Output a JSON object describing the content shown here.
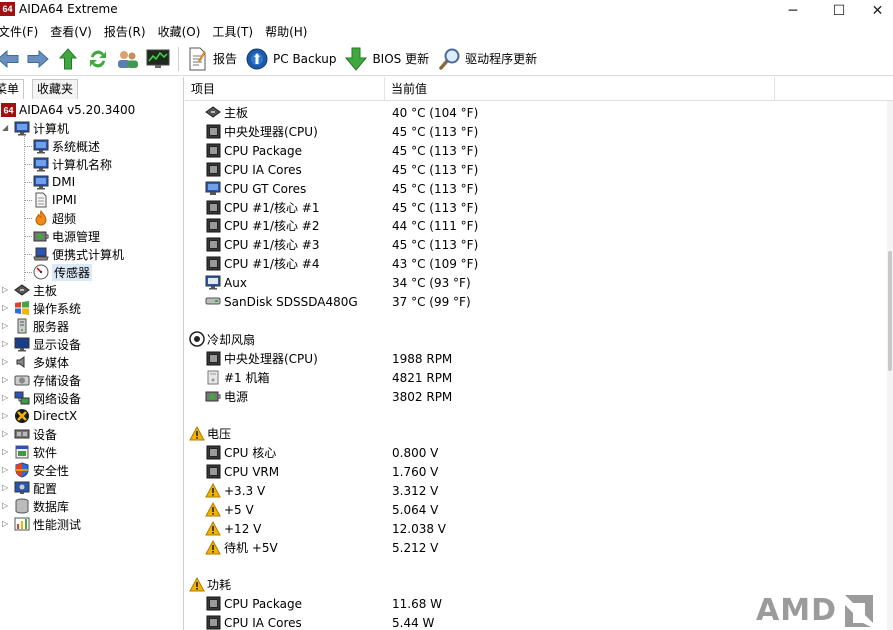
{
  "window": {
    "title": "AIDA64 Extreme",
    "app_icon_text": "64",
    "minimize": "─",
    "maximize": "☐",
    "close": "✕"
  },
  "menu": [
    "文件(F)",
    "查看(V)",
    "报告(R)",
    "收藏(O)",
    "工具(T)",
    "帮助(H)"
  ],
  "toolbar": {
    "report": "报告",
    "pc_backup": "PC Backup",
    "bios_update": "BIOS 更新",
    "driver_update": "驱动程序更新"
  },
  "left_panel": {
    "tab_menu": "菜单",
    "tab_favorites": "收藏夹",
    "tree": [
      {
        "label": "AIDA64 v5.20.3400",
        "icon": "aida64-icon",
        "level": 0
      },
      {
        "label": "计算机",
        "icon": "computer-icon",
        "level": 0,
        "expanded": true
      },
      {
        "label": "系统概述",
        "icon": "monitor-icon",
        "level": 1
      },
      {
        "label": "计算机名称",
        "icon": "monitor-icon",
        "level": 1
      },
      {
        "label": "DMI",
        "icon": "monitor-icon",
        "level": 1
      },
      {
        "label": "IPMI",
        "icon": "document-icon",
        "level": 1
      },
      {
        "label": "超频",
        "icon": "flame-icon",
        "level": 1
      },
      {
        "label": "电源管理",
        "icon": "power-icon",
        "level": 1
      },
      {
        "label": "便携式计算机",
        "icon": "laptop-icon",
        "level": 1
      },
      {
        "label": "传感器",
        "icon": "gauge-icon",
        "level": 1,
        "selected": true
      },
      {
        "label": "主板",
        "icon": "motherboard-icon",
        "level": 0
      },
      {
        "label": "操作系统",
        "icon": "windows-icon",
        "level": 0
      },
      {
        "label": "服务器",
        "icon": "server-icon",
        "level": 0
      },
      {
        "label": "显示设备",
        "icon": "display-icon",
        "level": 0
      },
      {
        "label": "多媒体",
        "icon": "speaker-icon",
        "level": 0
      },
      {
        "label": "存储设备",
        "icon": "storage-icon",
        "level": 0
      },
      {
        "label": "网络设备",
        "icon": "network-icon",
        "level": 0
      },
      {
        "label": "DirectX",
        "icon": "directx-icon",
        "level": 0
      },
      {
        "label": "设备",
        "icon": "device-icon",
        "level": 0
      },
      {
        "label": "软件",
        "icon": "software-icon",
        "level": 0
      },
      {
        "label": "安全性",
        "icon": "shield-icon",
        "level": 0
      },
      {
        "label": "配置",
        "icon": "config-icon",
        "level": 0
      },
      {
        "label": "数据库",
        "icon": "database-icon",
        "level": 0
      },
      {
        "label": "性能测试",
        "icon": "benchmark-icon",
        "level": 0
      }
    ]
  },
  "right_panel": {
    "col_item": "项目",
    "col_value": "当前值",
    "rows": [
      {
        "type": "item",
        "icon": "motherboard-icon",
        "name": "主板",
        "value": "40 °C  (104 °F)"
      },
      {
        "type": "item",
        "icon": "cpu-icon",
        "name": "中央处理器(CPU)",
        "value": "45 °C  (113 °F)"
      },
      {
        "type": "item",
        "icon": "cpu-icon",
        "name": "CPU Package",
        "value": "45 °C  (113 °F)"
      },
      {
        "type": "item",
        "icon": "cpu-icon",
        "name": "CPU IA Cores",
        "value": "45 °C  (113 °F)"
      },
      {
        "type": "item",
        "icon": "gpu-icon",
        "name": "CPU GT Cores",
        "value": "45 °C  (113 °F)"
      },
      {
        "type": "item",
        "icon": "cpu-icon",
        "name": "CPU #1/核心 #1",
        "value": "45 °C  (113 °F)"
      },
      {
        "type": "item",
        "icon": "cpu-icon",
        "name": "CPU #1/核心 #2",
        "value": "44 °C  (111 °F)"
      },
      {
        "type": "item",
        "icon": "cpu-icon",
        "name": "CPU #1/核心 #3",
        "value": "45 °C  (113 °F)"
      },
      {
        "type": "item",
        "icon": "cpu-icon",
        "name": "CPU #1/核心 #4",
        "value": "43 °C  (109 °F)"
      },
      {
        "type": "item",
        "icon": "aux-icon",
        "name": "Aux",
        "value": "34 °C  (93 °F)"
      },
      {
        "type": "item",
        "icon": "disk-icon",
        "name": "SanDisk SDSSDA480G",
        "value": "37 °C  (99 °F)"
      },
      {
        "type": "blank"
      },
      {
        "type": "group",
        "icon": "fan-icon",
        "name": "冷却风扇"
      },
      {
        "type": "item",
        "icon": "cpu-icon",
        "name": "中央处理器(CPU)",
        "value": "1988 RPM"
      },
      {
        "type": "item",
        "icon": "case-icon",
        "name": "#1 机箱",
        "value": "4821 RPM"
      },
      {
        "type": "item",
        "icon": "power-icon",
        "name": "电源",
        "value": "3802 RPM"
      },
      {
        "type": "blank"
      },
      {
        "type": "group",
        "icon": "warning-icon",
        "name": "电压"
      },
      {
        "type": "item",
        "icon": "cpu-icon",
        "name": "CPU 核心",
        "value": "0.800 V"
      },
      {
        "type": "item",
        "icon": "cpu-icon",
        "name": "CPU VRM",
        "value": "1.760 V"
      },
      {
        "type": "item",
        "icon": "warning-icon",
        "name": "+3.3 V",
        "value": "3.312 V"
      },
      {
        "type": "item",
        "icon": "warning-icon",
        "name": "+5 V",
        "value": "5.064 V"
      },
      {
        "type": "item",
        "icon": "warning-icon",
        "name": "+12 V",
        "value": "12.038 V"
      },
      {
        "type": "item",
        "icon": "warning-icon",
        "name": "待机 +5V",
        "value": "5.212 V"
      },
      {
        "type": "blank"
      },
      {
        "type": "group",
        "icon": "warning-icon",
        "name": "功耗"
      },
      {
        "type": "item",
        "icon": "cpu-icon",
        "name": "CPU Package",
        "value": "11.68 W"
      },
      {
        "type": "item",
        "icon": "cpu-icon",
        "name": "CPU IA Cores",
        "value": "5.44 W"
      }
    ]
  },
  "watermark": {
    "text": "AMD"
  },
  "colors": {
    "accent": "#0a64c8",
    "selection": "#dbe8f6",
    "warning": "#f2b400"
  }
}
